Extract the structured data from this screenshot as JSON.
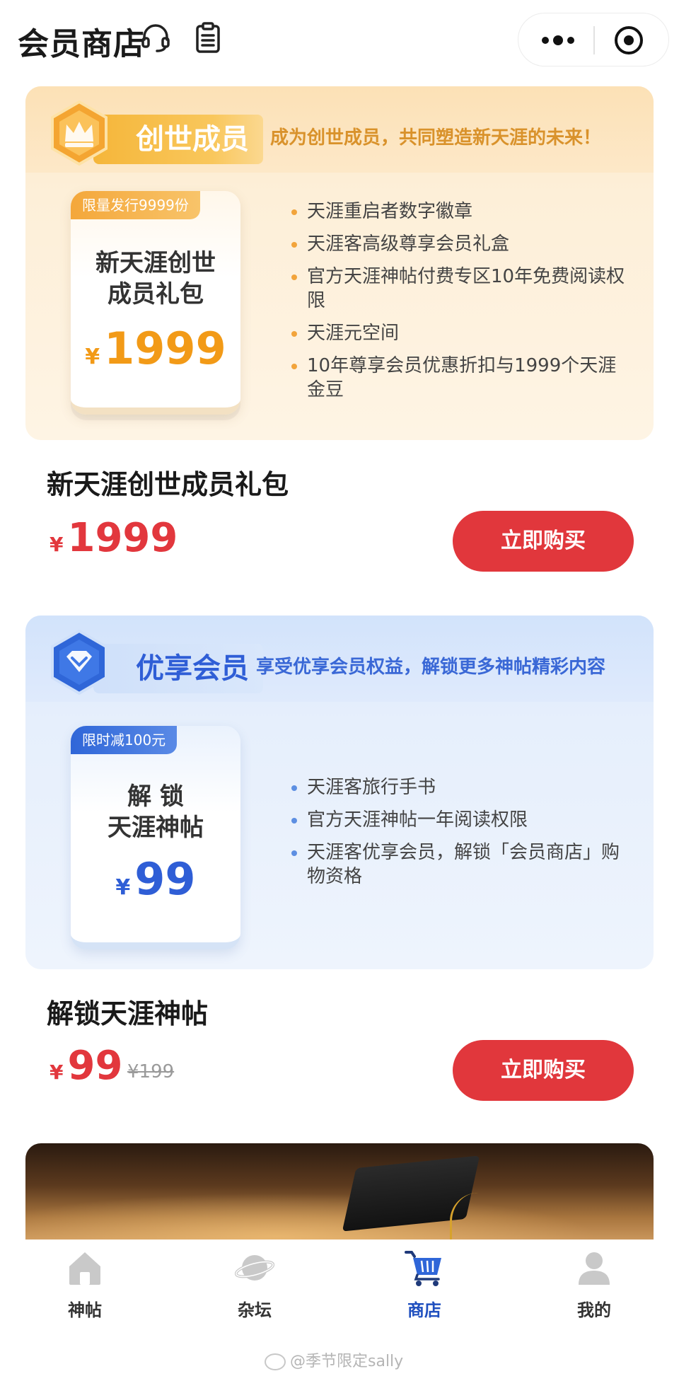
{
  "header": {
    "title": "会员商店"
  },
  "banners": [
    {
      "tier_name": "创世成员",
      "tagline": "成为创世成员，共同塑造新天涯的未来！",
      "ribbon": "限量发行9999份",
      "package_name_line1": "新天涯创世",
      "package_name_line2": "成员礼包",
      "currency": "¥",
      "price": "1999",
      "benefits": [
        "天涯重启者数字徽章",
        "天涯客高级尊享会员礼盒",
        "官方天涯神帖付费专区10年免费阅读权限",
        "天涯元空间",
        "10年尊享会员优惠折扣与1999个天涯金豆"
      ]
    },
    {
      "tier_name": "优享会员",
      "tagline": "享受优享会员权益，解锁更多神帖精彩内容",
      "ribbon": "限时减100元",
      "package_name_line1": "解 锁",
      "package_name_line2": "天涯神帖",
      "currency": "¥",
      "price": "99",
      "benefits": [
        "天涯客旅行手书",
        "官方天涯神帖一年阅读权限",
        "天涯客优享会员，解锁「会员商店」购物资格"
      ]
    }
  ],
  "products": [
    {
      "title": "新天涯创世成员礼包",
      "currency": "¥",
      "price": "1999",
      "buy_label": "立即购买"
    },
    {
      "title": "解锁天涯神帖",
      "currency": "¥",
      "price": "99",
      "original_price": "¥199",
      "buy_label": "立即购买"
    }
  ],
  "tabbar": {
    "items": [
      {
        "label": "神帖",
        "icon": "home-icon"
      },
      {
        "label": "杂坛",
        "icon": "planet-icon"
      },
      {
        "label": "商店",
        "icon": "cart-icon",
        "active": true
      },
      {
        "label": "我的",
        "icon": "user-icon"
      }
    ]
  },
  "watermark": "@季节限定sally",
  "colors": {
    "accent_red": "#e1373c",
    "gold": "#f29a17",
    "blue": "#2f5ed6",
    "active_tab": "#1f4fbf"
  }
}
